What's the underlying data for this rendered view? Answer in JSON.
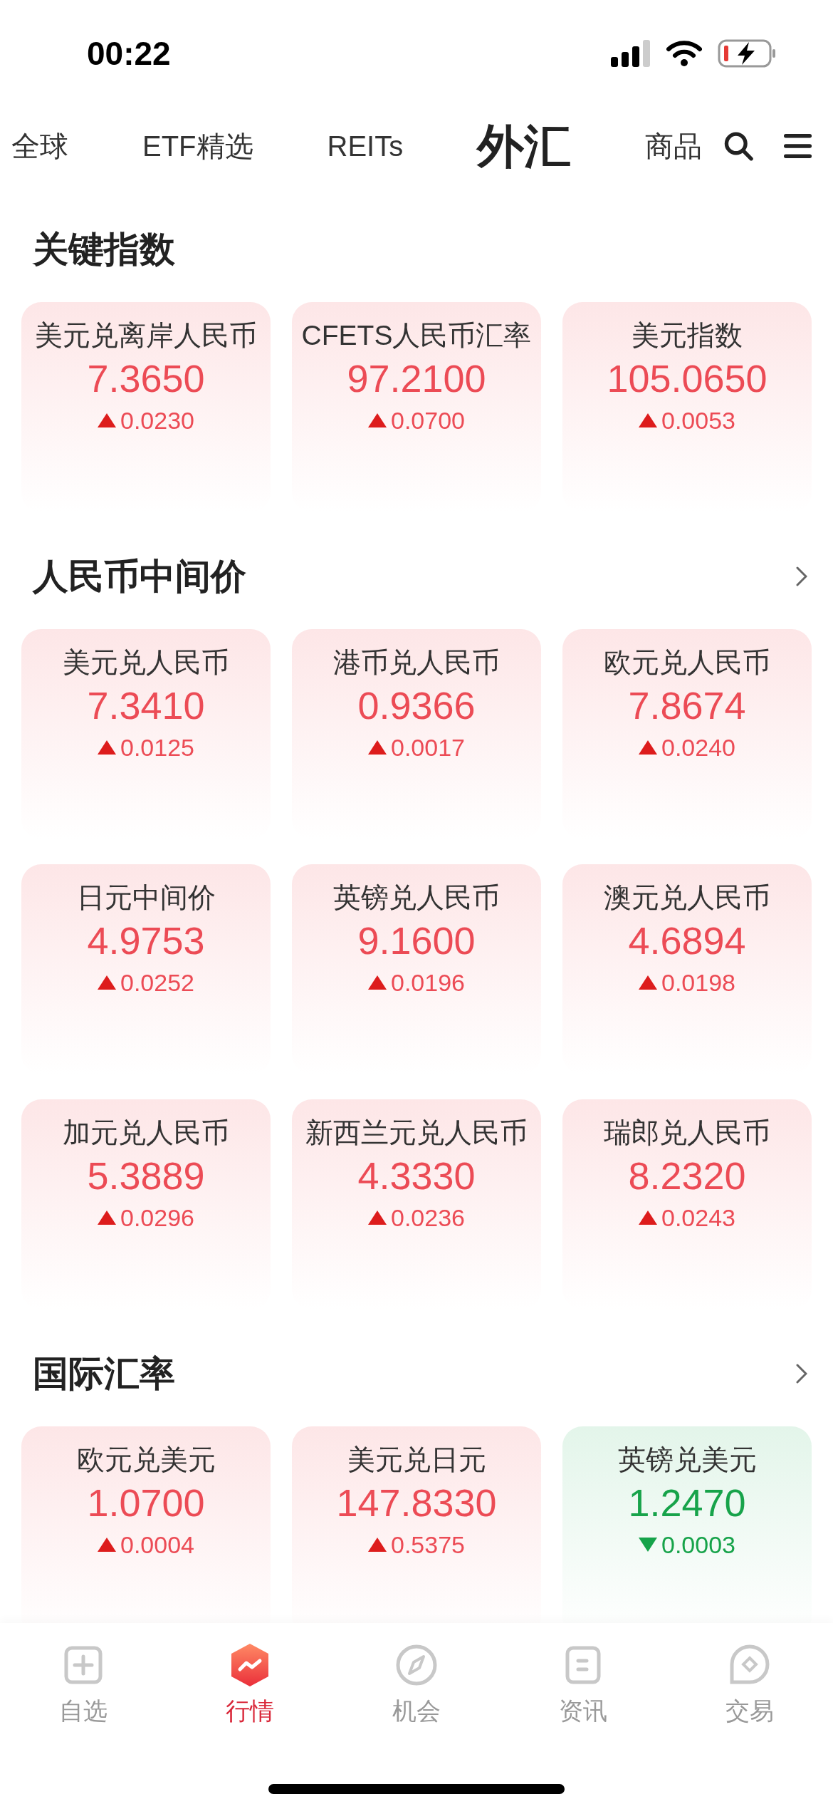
{
  "status_bar": {
    "time": "00:22"
  },
  "tabs": [
    {
      "label": "全球",
      "selected": false
    },
    {
      "label": "ETF精选",
      "selected": false
    },
    {
      "label": "REITs",
      "selected": false
    },
    {
      "label": "外汇",
      "selected": true
    },
    {
      "label": "商品",
      "selected": false
    }
  ],
  "sections": [
    {
      "title": "关键指数",
      "has_more": false,
      "cards": [
        {
          "name": "美元兑离岸人民币",
          "value": "7.3650",
          "change": "0.0230",
          "kind": "up"
        },
        {
          "name": "CFETS人民币汇率",
          "value": "97.2100",
          "change": "0.0700",
          "kind": "up"
        },
        {
          "name": "美元指数",
          "value": "105.0650",
          "change": "0.0053",
          "kind": "up"
        }
      ]
    },
    {
      "title": "人民币中间价",
      "has_more": true,
      "cards": [
        {
          "name": "美元兑人民币",
          "value": "7.3410",
          "change": "0.0125",
          "kind": "up"
        },
        {
          "name": "港币兑人民币",
          "value": "0.9366",
          "change": "0.0017",
          "kind": "up"
        },
        {
          "name": "欧元兑人民币",
          "value": "7.8674",
          "change": "0.0240",
          "kind": "up"
        },
        {
          "name": "日元中间价",
          "value": "4.9753",
          "change": "0.0252",
          "kind": "up"
        },
        {
          "name": "英镑兑人民币",
          "value": "9.1600",
          "change": "0.0196",
          "kind": "up"
        },
        {
          "name": "澳元兑人民币",
          "value": "4.6894",
          "change": "0.0198",
          "kind": "up"
        },
        {
          "name": "加元兑人民币",
          "value": "5.3889",
          "change": "0.0296",
          "kind": "up"
        },
        {
          "name": "新西兰元兑人民币",
          "value": "4.3330",
          "change": "0.0236",
          "kind": "up"
        },
        {
          "name": "瑞郎兑人民币",
          "value": "8.2320",
          "change": "0.0243",
          "kind": "up"
        }
      ]
    },
    {
      "title": "国际汇率",
      "has_more": true,
      "cards": [
        {
          "name": "欧元兑美元",
          "value": "1.0700",
          "change": "0.0004",
          "kind": "up"
        },
        {
          "name": "美元兑日元",
          "value": "147.8330",
          "change": "0.5375",
          "kind": "up"
        },
        {
          "name": "英镑兑美元",
          "value": "1.2470",
          "change": "0.0003",
          "kind": "down"
        }
      ]
    }
  ],
  "bottom_nav": [
    {
      "label": "自选",
      "selected": false,
      "kind": "plus"
    },
    {
      "label": "行情",
      "selected": true,
      "kind": "market"
    },
    {
      "label": "机会",
      "selected": false,
      "kind": "compass"
    },
    {
      "label": "资讯",
      "selected": false,
      "kind": "news"
    },
    {
      "label": "交易",
      "selected": false,
      "kind": "trade"
    }
  ]
}
